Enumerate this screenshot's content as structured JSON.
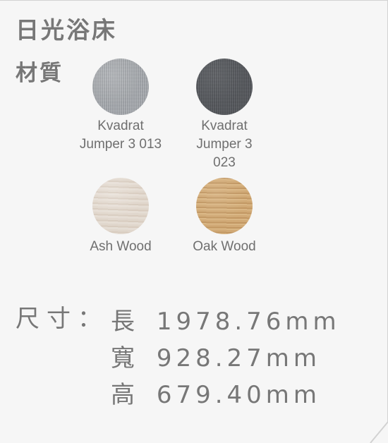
{
  "title": "日光浴床",
  "materials_heading": "材質",
  "materials": [
    {
      "label_lines": [
        "Kvadrat",
        "Jumper 3 013"
      ],
      "swatch": "gray fabric",
      "color": "#9ca0a5"
    },
    {
      "label_lines": [
        "Kvadrat",
        "Jumper 3",
        "023"
      ],
      "swatch": "charcoal fabric",
      "color": "#54575c"
    },
    {
      "label_lines": [
        "Ash Wood"
      ],
      "swatch": "ash wood",
      "color": "#ddd2c6"
    },
    {
      "label_lines": [
        "Oak Wood"
      ],
      "swatch": "oak wood",
      "color": "#c9a06c"
    }
  ],
  "dimensions": {
    "label": "尺寸：",
    "rows": [
      {
        "label": "長",
        "value": "1978.76mm"
      },
      {
        "label": "寬",
        "value": "928.27mm"
      },
      {
        "label": "高",
        "value": "679.40mm"
      }
    ]
  }
}
